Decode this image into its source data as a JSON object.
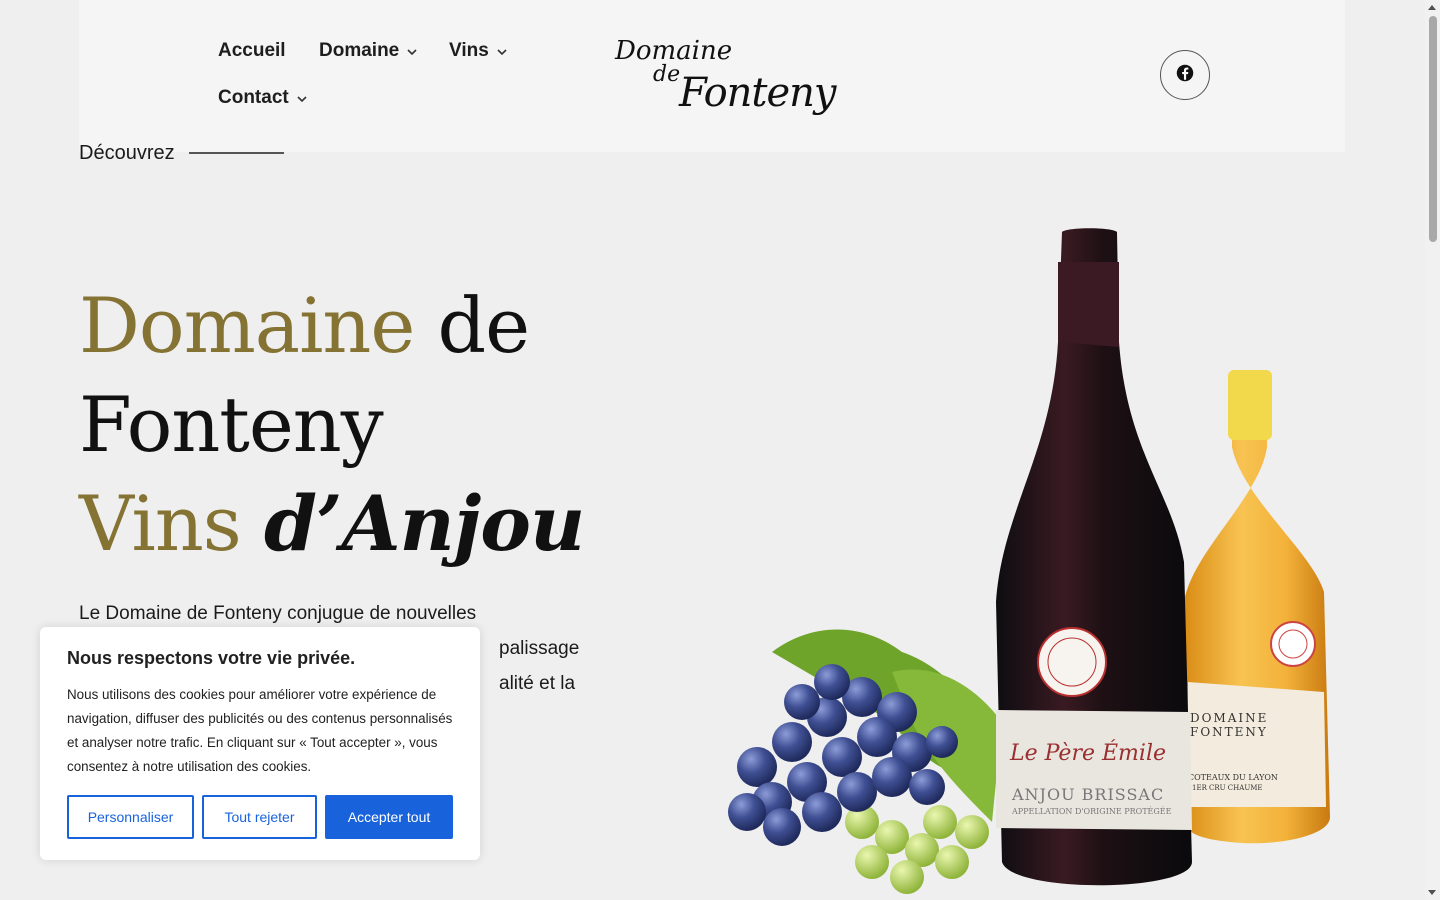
{
  "header": {
    "nav": [
      {
        "label": "Accueil",
        "dropdown": false
      },
      {
        "label": "Domaine",
        "dropdown": true
      },
      {
        "label": "Vins",
        "dropdown": true
      },
      {
        "label": "Contact",
        "dropdown": true
      }
    ],
    "logo": {
      "line1": "Domaine",
      "line2": "de",
      "line3": "Fonteny"
    },
    "social_icon": "facebook-icon"
  },
  "hero": {
    "eyebrow": "Découvrez",
    "title_line1_a": "Domaine",
    "title_line1_b": " de",
    "title_line2": "Fonteny",
    "title_line3_a": "Vins ",
    "title_line3_b": "d’Anjou",
    "description": "Le Domaine de Fonteny conjugue de nouvelles [...] palissage [...] alité et la",
    "accent_color": "#857334"
  },
  "bottles": {
    "red_label_name": "Le Père Émile",
    "red_label_app": "ANJOU BRISSAC",
    "red_label_sub": "APPELLATION D'ORIGINE PROTÉGÉE",
    "white_label_name": "DOMAINE FONTENY",
    "white_label_app": "COTEAUX DU LAYON",
    "white_label_sub": "1ER CRU CHAUME"
  },
  "cookie": {
    "title": "Nous respectons votre vie privée.",
    "text": "Nous utilisons des cookies pour améliorer votre expérience de navigation, diffuser des publicités ou des contenus personnalisés et analyser notre trafic. En cliquant sur « Tout accepter », vous consentez à notre utilisation des cookies.",
    "btn_customize": "Personnaliser",
    "btn_reject": "Tout rejeter",
    "btn_accept": "Accepter tout",
    "button_color": "#1863dc"
  }
}
